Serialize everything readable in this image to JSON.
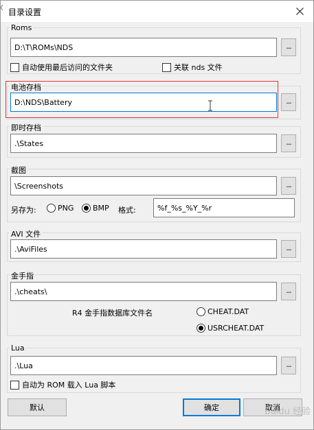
{
  "window": {
    "title": "目录设置"
  },
  "roms": {
    "label": "Roms",
    "path": "D:\\T\\ROMs\\NDS",
    "browse": "...",
    "auto_last_folder": {
      "label": "自动使用最后访问的文件夹",
      "checked": false
    },
    "associate_nds": {
      "label": "关联 nds 文件",
      "checked": false
    }
  },
  "battery": {
    "label": "电池存档",
    "path": "D:\\NDS\\Battery",
    "browse": "..."
  },
  "states": {
    "label": "即时存档",
    "path": ".\\States",
    "browse": "..."
  },
  "screenshots": {
    "label": "截图",
    "path": "\\Screenshots",
    "browse": "...",
    "save_as_label": "另存为:",
    "png_label": "PNG",
    "bmp_label": "BMP",
    "selected_format": "BMP",
    "format_label": "格式:",
    "format_value": "%f_%s_%Y_%r"
  },
  "avi": {
    "label": "AVI 文件",
    "path": ".\\AviFiles",
    "browse": "..."
  },
  "cheats": {
    "label": "金手指",
    "path": ".\\cheats\\",
    "browse": "...",
    "db_label": "R4 金手指数据库文件名",
    "option_cheat": "CHEAT.DAT",
    "option_usr": "USRCHEAT.DAT",
    "selected": "USRCHEAT.DAT"
  },
  "lua": {
    "label": "Lua",
    "path": ".\\Lua",
    "browse": "...",
    "autoload": {
      "label": "自动为 ROM 载入 Lua 脚本",
      "checked": false
    }
  },
  "buttons": {
    "default": "默认",
    "ok": "确定",
    "cancel": "取消"
  },
  "watermark": "Baidu 经验",
  "colors": {
    "highlight_box": "#e0353b",
    "focus_border": "#0078d7"
  }
}
